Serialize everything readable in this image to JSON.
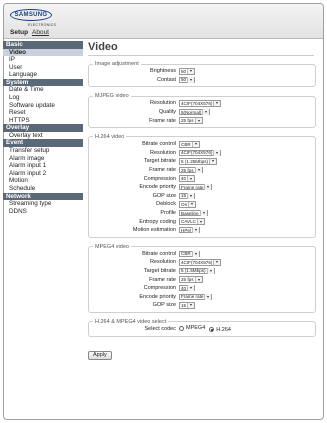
{
  "brand": {
    "logo_text": "SAMSUNG",
    "logo_sub": "ELECTRONICS"
  },
  "topnav": {
    "setup": "Setup",
    "about": "About"
  },
  "sidebar": [
    {
      "section": "Basic",
      "items": [
        "Video",
        "IP",
        "User",
        "Language"
      ]
    },
    {
      "section": "System",
      "items": [
        "Date & Time",
        "Log",
        "Software update",
        "Reset",
        "HTTPS"
      ]
    },
    {
      "section": "Overlay",
      "items": [
        "Overlay text"
      ]
    },
    {
      "section": "Event",
      "items": [
        "Transfer setup",
        "Alarm image",
        "Alarm input 1",
        "Alarm input 2",
        "Motion",
        "Schedule"
      ]
    },
    {
      "section": "Network",
      "items": [
        "Streaming type",
        "DDNS"
      ]
    }
  ],
  "active_item": "Video",
  "page_title": "Video",
  "image_adjustment": {
    "legend": "Image adjustment",
    "brightness_label": "Brightness",
    "brightness": "50",
    "contrast_label": "Contast",
    "contrast": "50"
  },
  "mjpeg": {
    "legend": "MJPEG video",
    "resolution_label": "Resolution",
    "resolution": "4CIF(704X576)",
    "quality_label": "Quality",
    "quality": "5(Normal)",
    "framerate_label": "Frame rate",
    "framerate": "25 fps"
  },
  "h264": {
    "legend": "H.264 video",
    "rows": [
      {
        "name": "bitrate-control",
        "label": "Bitrate control",
        "value": "CBR"
      },
      {
        "name": "resolution",
        "label": "Resolution",
        "value": "4CIF(704X576)"
      },
      {
        "name": "target-bitrate",
        "label": "Target bitrate",
        "value": "5 (1.25Mbps)"
      },
      {
        "name": "frame-rate",
        "label": "Frame rate",
        "value": "25 fps"
      },
      {
        "name": "compression",
        "label": "Compression",
        "value": "40"
      },
      {
        "name": "encode-priority",
        "label": "Encode priority",
        "value": "Frame rate"
      },
      {
        "name": "gop-size",
        "label": "GOP size",
        "value": "15"
      },
      {
        "name": "deblock",
        "label": "Deblock",
        "value": "On"
      },
      {
        "name": "profile",
        "label": "Profile",
        "value": "Baseline"
      },
      {
        "name": "entropy-coding",
        "label": "Entropy coding",
        "value": "CAVLC"
      },
      {
        "name": "motion-estimation",
        "label": "Motion estimation",
        "value": "HPel"
      }
    ]
  },
  "mpeg4": {
    "legend": "MPEG4 video",
    "rows": [
      {
        "name": "bitrate-control",
        "label": "Bitrate control",
        "value": "CBR"
      },
      {
        "name": "resolution",
        "label": "Resolution",
        "value": "4CIF(704X576)"
      },
      {
        "name": "target-bitrate",
        "label": "Target bitrate",
        "value": "5 (1.5Mbps)"
      },
      {
        "name": "frame-rate",
        "label": "Frame rate",
        "value": "25 fps"
      },
      {
        "name": "compression",
        "label": "Compression",
        "value": "40"
      },
      {
        "name": "encode-priority",
        "label": "Encode priority",
        "value": "Frame rate"
      },
      {
        "name": "gop-size",
        "label": "GOP size",
        "value": "15"
      }
    ]
  },
  "codec_select": {
    "legend": "H.264 & MPEG4 video select",
    "label": "Select codec",
    "options": [
      "MPEG4",
      "H.264"
    ],
    "selected": "H.264"
  },
  "apply_label": "Apply"
}
